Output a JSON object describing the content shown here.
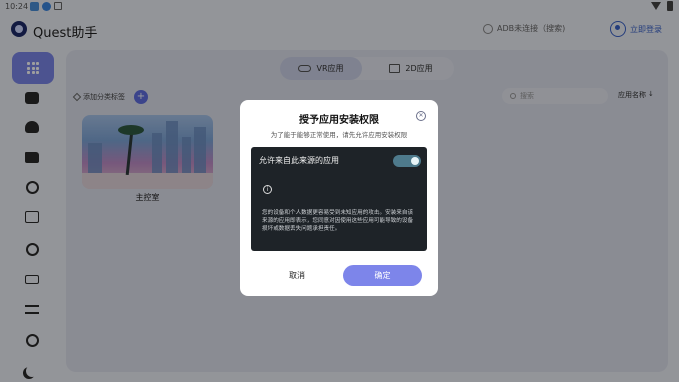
{
  "statusbar": {
    "time": "10:24"
  },
  "header": {
    "app_title": "Quest助手",
    "adb_status": "ADB未连接（搜索)",
    "login": "立即登录"
  },
  "sidebar": {
    "items": [
      "apps-icon",
      "gamepad-icon",
      "cloud-upload-icon",
      "folder-icon",
      "target-icon",
      "calendar-icon",
      "openai-icon",
      "keyboard-icon",
      "lines-icon",
      "settings-icon",
      "moon-icon"
    ]
  },
  "main": {
    "tabs": [
      {
        "label": "VR应用",
        "icon": "vr-headset-icon",
        "active": true
      },
      {
        "label": "2D应用",
        "icon": "image-icon",
        "active": false
      }
    ],
    "add_tag": "添加分类标签",
    "add_tag_plus": "+",
    "search_placeholder": "搜索",
    "sort_label": "应用名称",
    "sort_arrow": "↓",
    "apps": [
      {
        "label": "主控室"
      }
    ]
  },
  "dialog": {
    "title": "授予应用安装权限",
    "close": "✕",
    "subtitle": "为了能于能够正常使用，请先允许应用安装权限",
    "toggle_label": "允许来自此来源的应用",
    "toggle_on": true,
    "info": "i",
    "warning": "您的设备和个人数据更容易受到未知应用的攻击。安装来自该来源的应用即表示，您同意对因使用这些应用可能导致的设备损坏或数据丢失问题承担责任。",
    "cancel": "取消",
    "confirm": "确定"
  },
  "colors": {
    "accent": "#7d85ea",
    "dark_panel": "#1e2328",
    "sidebar_active": "#7b86e8"
  }
}
